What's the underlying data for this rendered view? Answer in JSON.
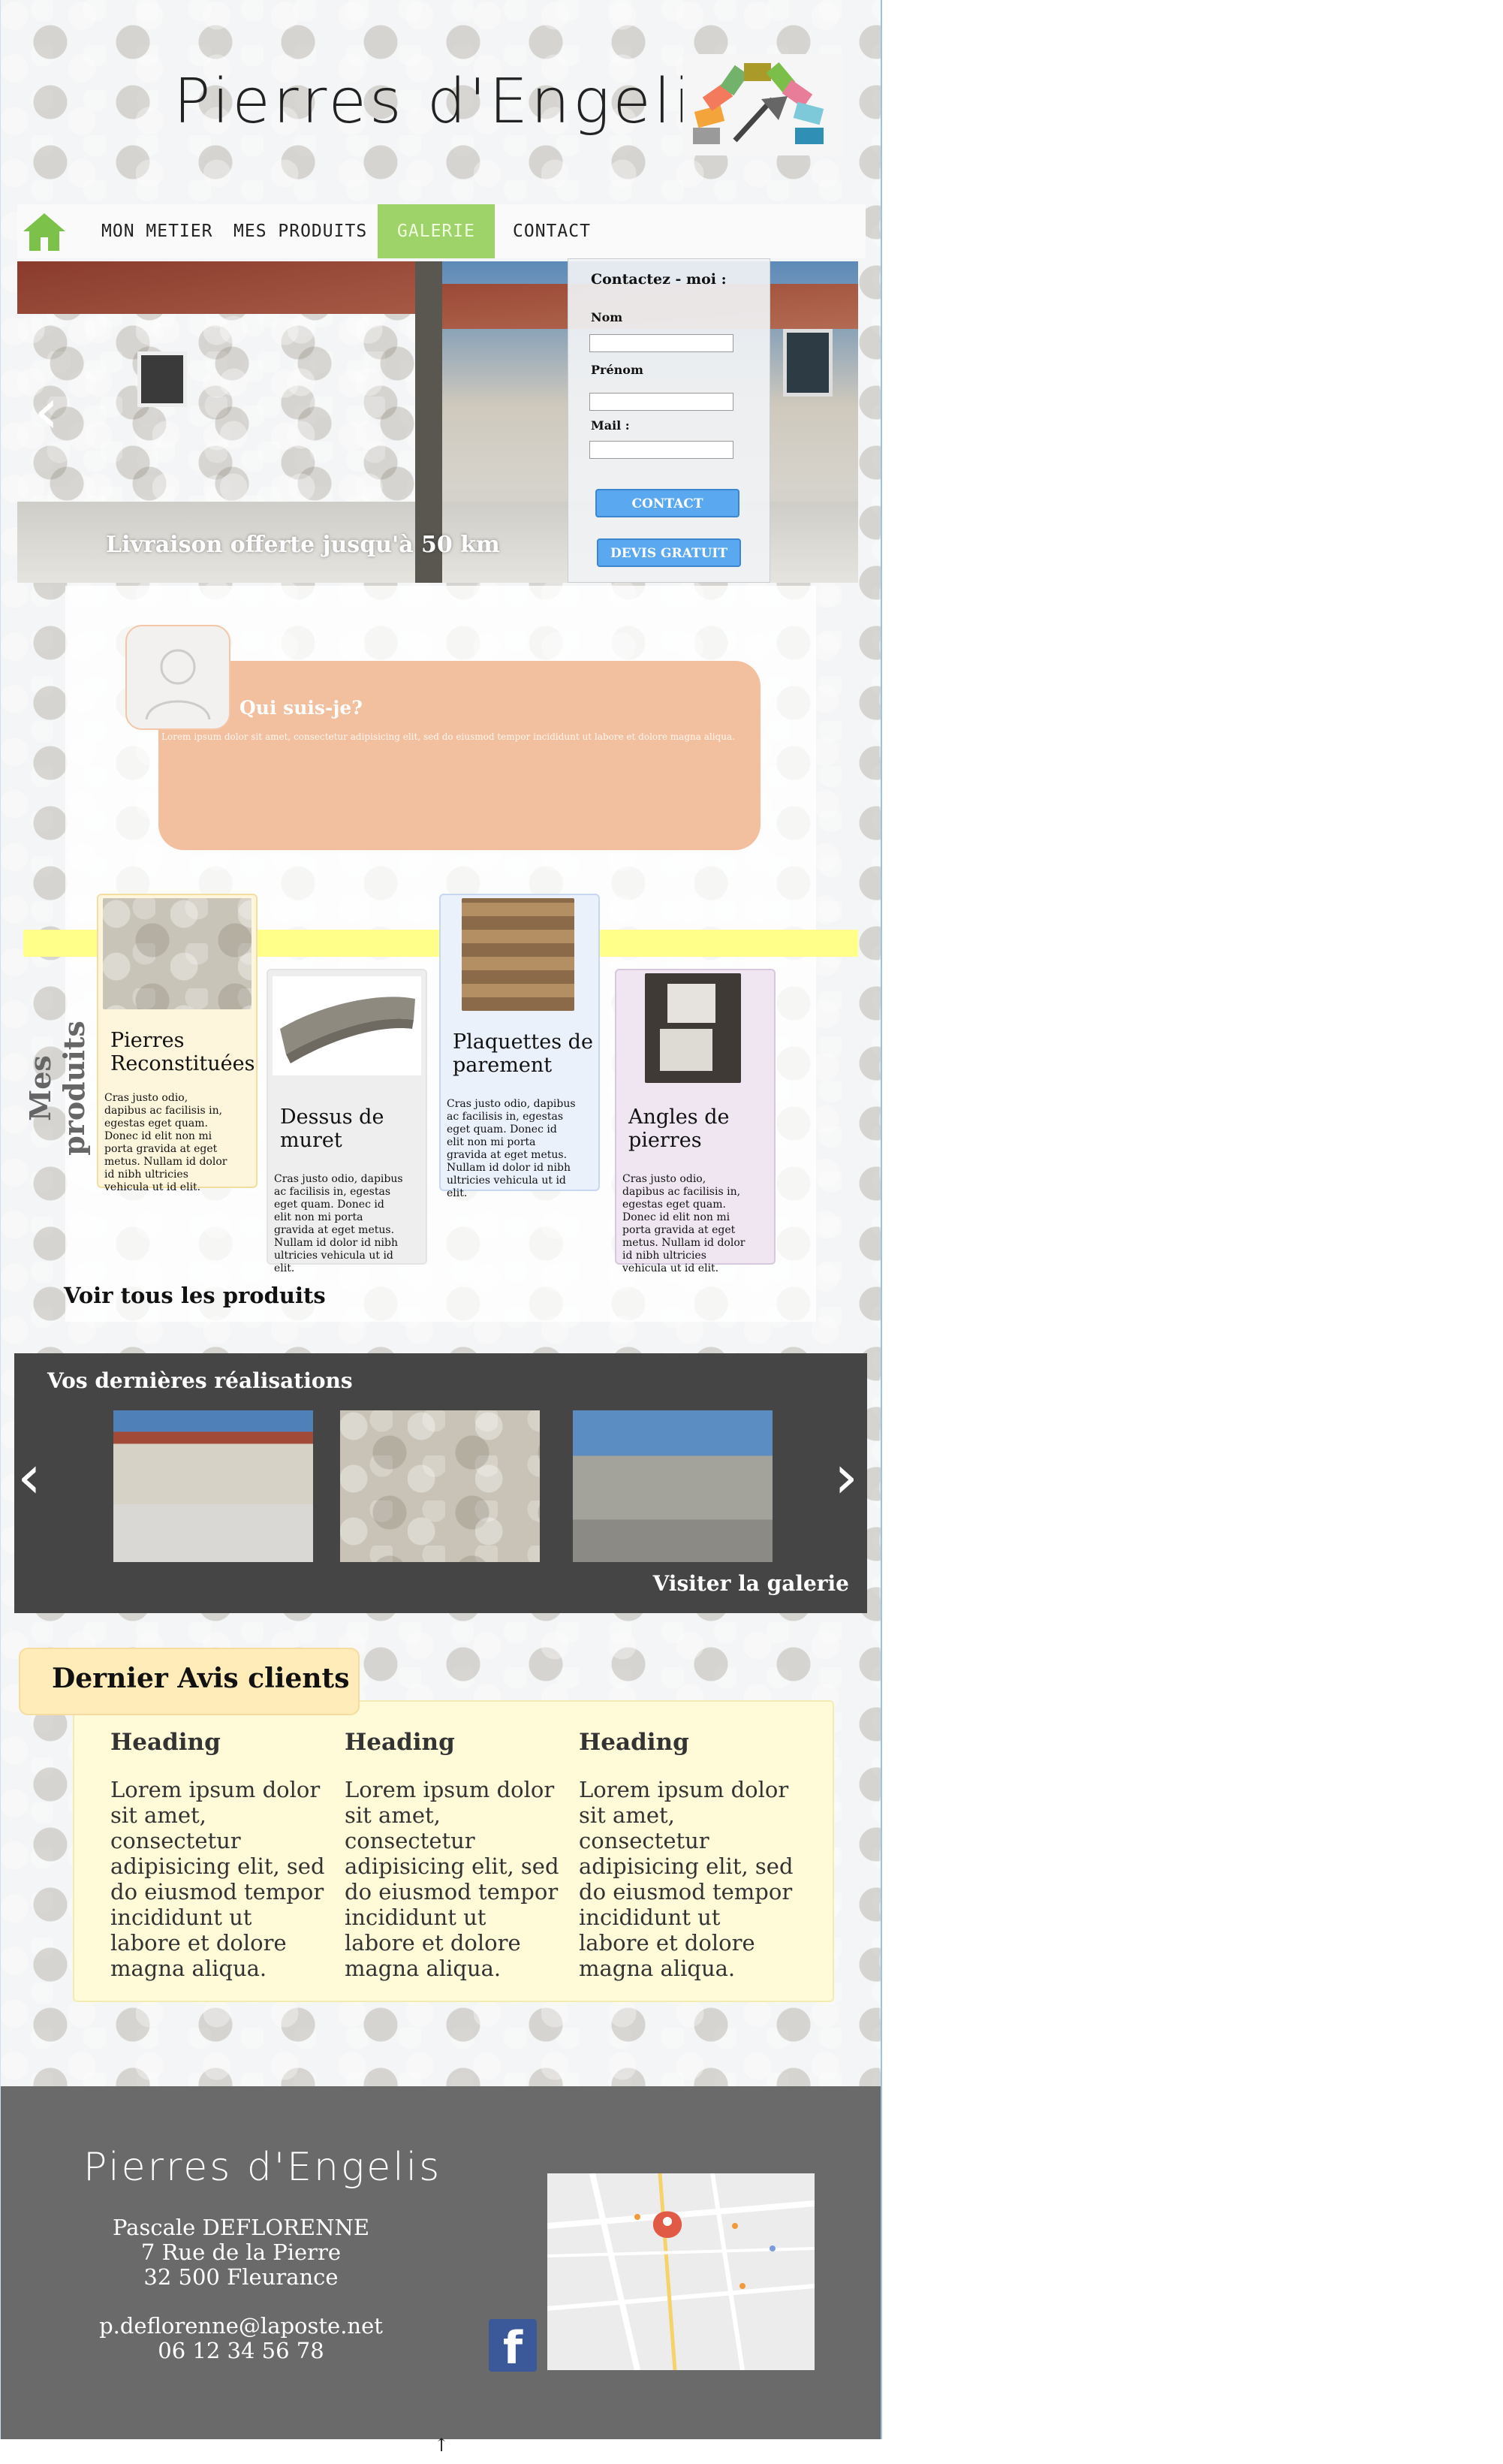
{
  "site": {
    "title": "Pierres d'Engelis"
  },
  "nav": {
    "items": [
      "MON METIER",
      "MES PRODUITS",
      "GALERIE",
      "CONTACT"
    ],
    "active": "GALERIE"
  },
  "hero": {
    "caption": "Livraison offerte jusqu'à 50 km",
    "prev_arrow": "‹"
  },
  "contact_form": {
    "title": "Contactez - moi :",
    "fields": [
      {
        "label": "Nom",
        "value": ""
      },
      {
        "label": "Prénom",
        "value": ""
      },
      {
        "label": "Mail :",
        "value": ""
      }
    ],
    "contact_button": "CONTACT",
    "quote_button": "DEVIS GRATUIT"
  },
  "about": {
    "title": "Qui suis-je?",
    "text": "Lorem ipsum dolor sit amet, consectetur adipisicing elit, sed do eiusmod tempor incididunt ut labore et dolore magna aliqua."
  },
  "products": {
    "section_title": "Mes produits",
    "items": [
      {
        "title": "Pierres Reconstituées",
        "text": "Cras justo odio, dapibus ac facilisis in, egestas eget quam. Donec id elit non mi porta gravida at eget metus. Nullam id dolor id nibh ultricies vehicula ut id elit."
      },
      {
        "title": "Dessus de muret",
        "text": "Cras justo odio, dapibus ac facilisis in, egestas eget quam. Donec id elit non mi porta gravida at eget metus. Nullam id dolor id nibh ultricies vehicula ut id elit."
      },
      {
        "title": "Plaquettes de parement",
        "text": "Cras justo odio, dapibus ac facilisis in, egestas eget quam. Donec id elit non mi porta gravida at eget metus. Nullam id dolor id nibh ultricies vehicula ut id elit."
      },
      {
        "title": "Angles de pierres",
        "text": "Cras justo odio, dapibus ac facilisis in, egestas eget quam. Donec id elit non mi porta gravida at eget metus. Nullam id dolor id nibh ultricies vehicula ut id elit."
      }
    ],
    "see_all": "Voir tous les produits"
  },
  "gallery": {
    "title": "Vos dernières réalisations",
    "prev": "‹",
    "next": "›",
    "link": "Visiter la galerie"
  },
  "reviews": {
    "title": "Dernier Avis clients",
    "items": [
      {
        "heading": "Heading",
        "text": "Lorem ipsum dolor sit amet, consectetur adipisicing elit, sed do eiusmod tempor incididunt ut labore et dolore magna aliqua."
      },
      {
        "heading": "Heading",
        "text": "Lorem ipsum dolor sit amet, consectetur adipisicing elit, sed do eiusmod tempor incididunt ut labore et dolore magna aliqua."
      },
      {
        "heading": "Heading",
        "text": "Lorem ipsum dolor sit amet, consectetur adipisicing elit, sed do eiusmod tempor incididunt ut labore et dolore magna aliqua."
      }
    ]
  },
  "footer": {
    "title": "Pierres d'Engelis",
    "name": "Pascale DEFLORENNE",
    "street": "7 Rue de la Pierre",
    "city": "32 500 Fleurance",
    "email": "p.deflorenne@laposte.net",
    "phone": "06 12 34 56 78",
    "facebook_glyph": "f"
  },
  "colors": {
    "nav_active": "#9ed36a",
    "about_bg": "#f2bf9f",
    "button_blue": "#5aa8f0",
    "gallery_bg": "#454545",
    "footer_bg": "#6a6a6a",
    "highlight_yellow": "#ffff8a"
  },
  "icons": [
    "home-icon",
    "chevron-left-icon",
    "chevron-right-icon",
    "user-icon",
    "facebook-icon",
    "map-pin-icon",
    "arrow-up-icon"
  ]
}
